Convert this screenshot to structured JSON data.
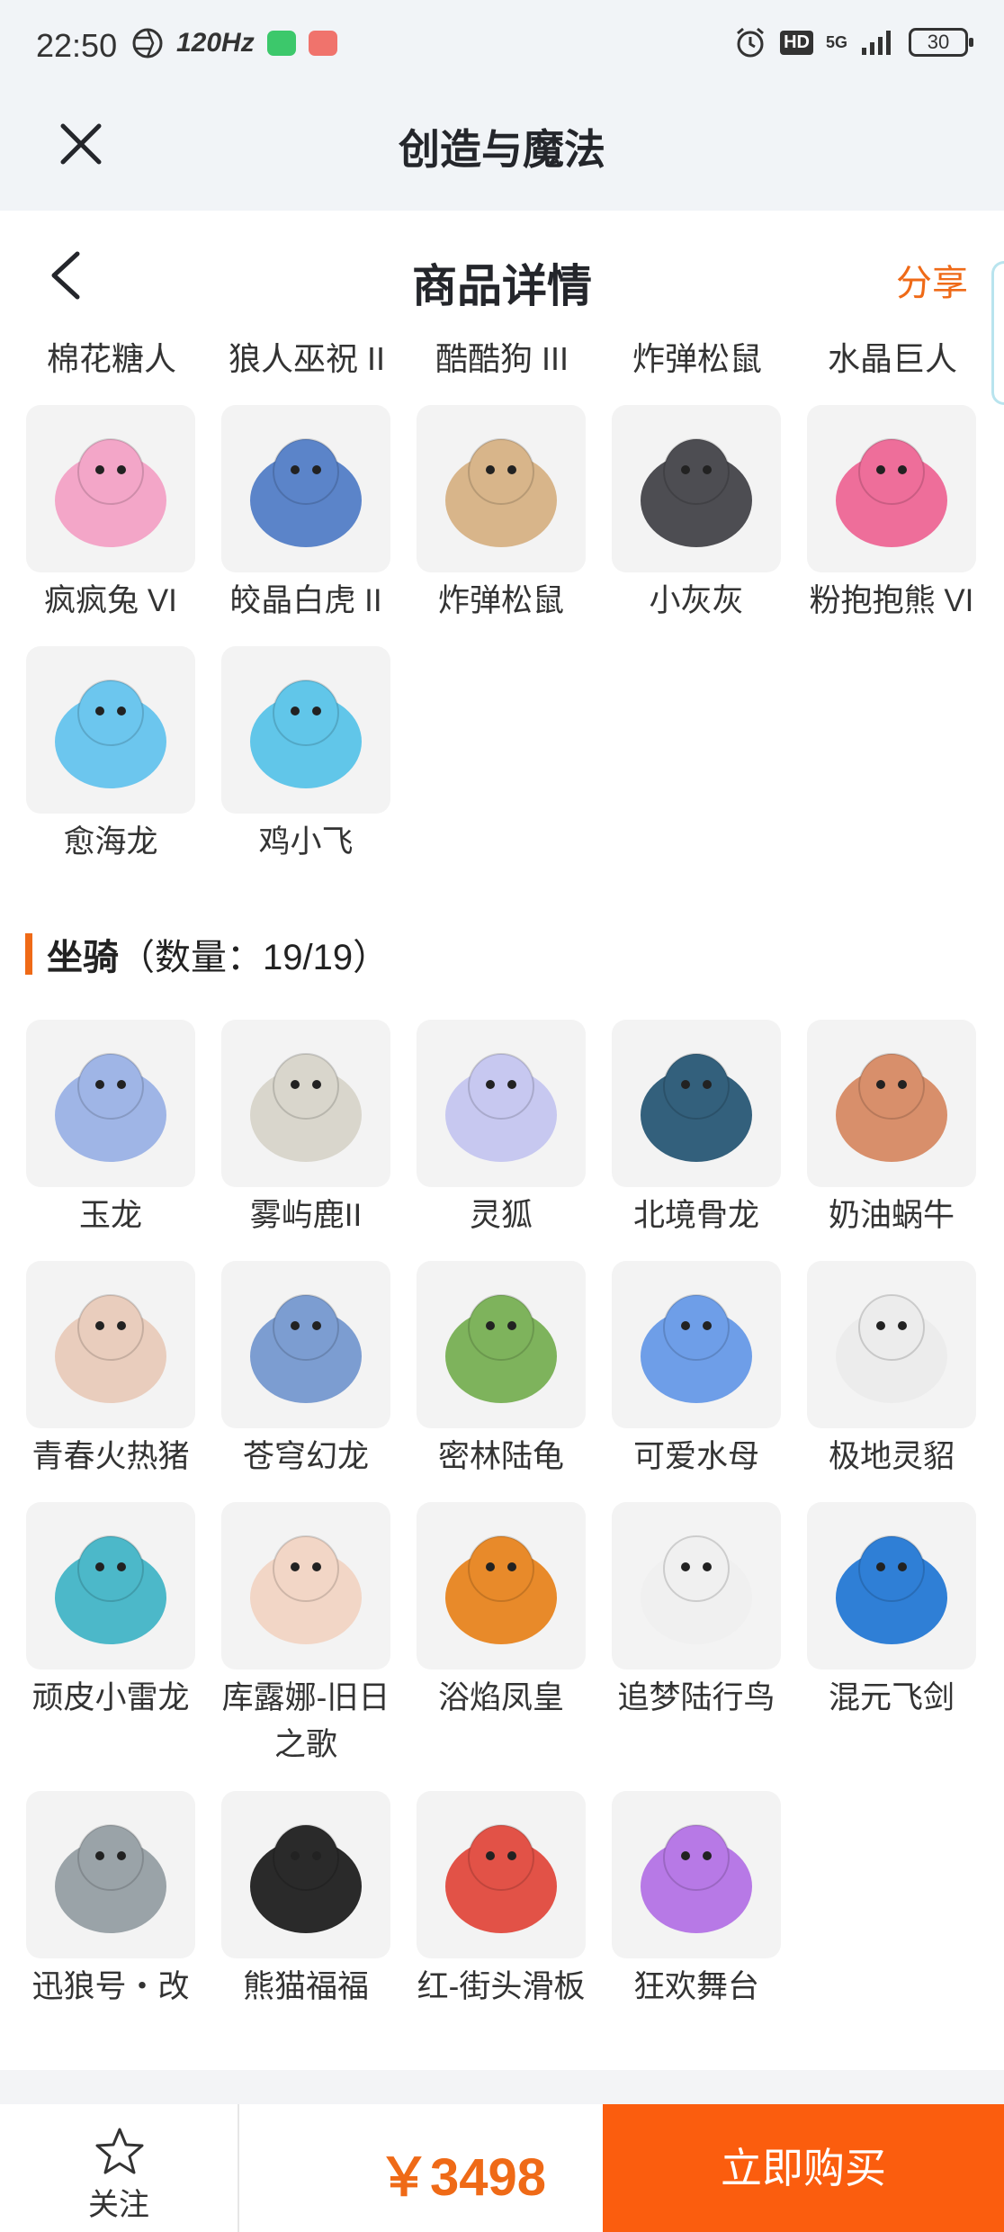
{
  "status_bar": {
    "time": "22:50",
    "refresh_rate": "120Hz",
    "hd": "HD",
    "network": "5G",
    "battery": "30"
  },
  "app_bar": {
    "title": "创造与魔法"
  },
  "detail": {
    "title": "商品详情",
    "share": "分享"
  },
  "top_names": [
    "棉花糖人",
    "狼人巫祝 II",
    "酷酷狗 III",
    "炸弹松鼠",
    "水晶巨人"
  ],
  "pets": [
    {
      "name": "疯疯兔 VI",
      "icon": "bunny-icon",
      "color": "#f3a6c8"
    },
    {
      "name": "皎晶白虎 II",
      "icon": "tiger-icon",
      "color": "#5b84c9"
    },
    {
      "name": "炸弹松鼠",
      "icon": "squirrel-icon",
      "color": "#d8b58a"
    },
    {
      "name": "小灰灰",
      "icon": "wolf-cub-icon",
      "color": "#4d4d52"
    },
    {
      "name": "粉抱抱熊 VI",
      "icon": "bear-icon",
      "color": "#ee6e9a"
    },
    {
      "name": "愈海龙",
      "icon": "sea-dragon-icon",
      "color": "#6cc6ee"
    },
    {
      "name": "鸡小飞",
      "icon": "chick-icon",
      "color": "#61c6e9"
    }
  ],
  "mounts_section": {
    "title": "坐骑",
    "count": "（数量：19/19）"
  },
  "mounts": [
    {
      "name": "玉龙",
      "icon": "jade-dragon-icon",
      "color": "#9fb5e6"
    },
    {
      "name": "雾屿鹿II",
      "icon": "deer-icon",
      "color": "#d9d6cc"
    },
    {
      "name": "灵狐",
      "icon": "fox-icon",
      "color": "#c7c8f0"
    },
    {
      "name": "北境骨龙",
      "icon": "bone-dragon-icon",
      "color": "#33607c"
    },
    {
      "name": "奶油蜗牛",
      "icon": "snail-icon",
      "color": "#d88f6b"
    },
    {
      "name": "青春火热猪",
      "icon": "pig-icon",
      "color": "#e9cdbd"
    },
    {
      "name": "苍穹幻龙",
      "icon": "sky-dragon-icon",
      "color": "#7c9dd1"
    },
    {
      "name": "密林陆龟",
      "icon": "tortoise-icon",
      "color": "#7eb35c"
    },
    {
      "name": "可爱水母",
      "icon": "jellyfish-icon",
      "color": "#6e9ee8"
    },
    {
      "name": "极地灵貂",
      "icon": "mink-icon",
      "color": "#ececec"
    },
    {
      "name": "顽皮小雷龙",
      "icon": "thunder-dragon-icon",
      "color": "#4cb8c9"
    },
    {
      "name": "库露娜-旧日之歌",
      "icon": "kuluna-icon",
      "color": "#f2d6c6"
    },
    {
      "name": "浴焰凤皇",
      "icon": "phoenix-icon",
      "color": "#e88a2a"
    },
    {
      "name": "追梦陆行鸟",
      "icon": "bird-icon",
      "color": "#f0f0f0"
    },
    {
      "name": "混元飞剑",
      "icon": "sword-icon",
      "color": "#2f7fd6"
    },
    {
      "name": "迅狼号・改",
      "icon": "mech-wolf-icon",
      "color": "#9aa3a8"
    },
    {
      "name": "熊猫福福",
      "icon": "panda-icon",
      "color": "#2a2a2a"
    },
    {
      "name": "红-街头滑板",
      "icon": "skateboard-icon",
      "color": "#e25247"
    },
    {
      "name": "狂欢舞台",
      "icon": "stage-icon",
      "color": "#b779e6"
    }
  ],
  "bottom": {
    "follow": "关注",
    "price": "￥3498",
    "buy": "立即购买"
  },
  "colors": {
    "accent": "#ef6a17",
    "buy": "#fb5d0e"
  }
}
